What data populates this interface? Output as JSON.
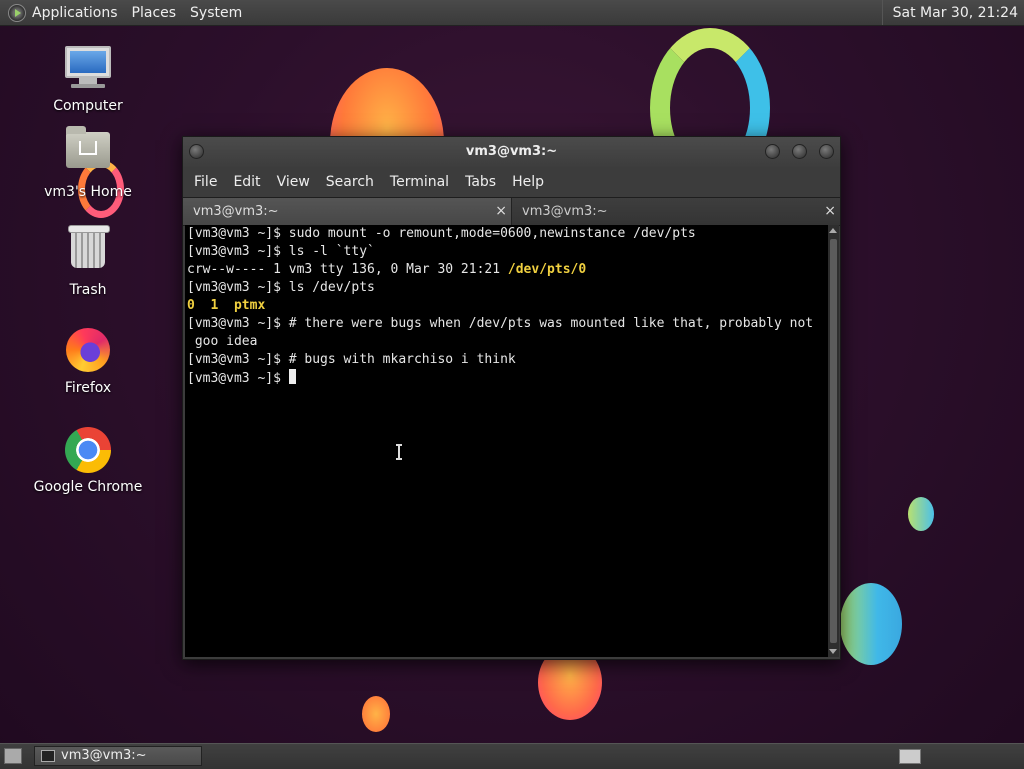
{
  "top_panel": {
    "menus": [
      "Applications",
      "Places",
      "System"
    ],
    "clock": "Sat Mar 30, 21:24"
  },
  "desktop_icons": [
    {
      "label": "Computer",
      "icon": "computer-icon"
    },
    {
      "label": "vm3's Home",
      "icon": "home-folder-icon"
    },
    {
      "label": "Trash",
      "icon": "trash-icon"
    },
    {
      "label": "Firefox",
      "icon": "firefox-icon"
    },
    {
      "label": "Google Chrome",
      "icon": "chrome-icon"
    }
  ],
  "terminal": {
    "title": "vm3@vm3:~",
    "menubar": [
      "File",
      "Edit",
      "View",
      "Search",
      "Terminal",
      "Tabs",
      "Help"
    ],
    "tabs": [
      {
        "label": "vm3@vm3:~",
        "active": true
      },
      {
        "label": "vm3@vm3:~",
        "active": false
      }
    ],
    "close_glyph": "×",
    "lines": [
      {
        "prompt": "[vm3@vm3 ~]$ ",
        "text": "sudo mount -o remount,mode=0600,newinstance /dev/pts"
      },
      {
        "prompt": "[vm3@vm3 ~]$ ",
        "text": "ls -l `tty`"
      },
      {
        "prompt": "",
        "text": "crw--w---- 1 vm3 tty 136, 0 Mar 30 21:21 ",
        "highlight": "/dev/pts/0"
      },
      {
        "prompt": "[vm3@vm3 ~]$ ",
        "text": "ls /dev/pts"
      },
      {
        "prompt": "",
        "text": "",
        "highlight": "0  1  ptmx"
      },
      {
        "prompt": "[vm3@vm3 ~]$ ",
        "text": "# there were bugs when /dev/pts was mounted like that, probably not"
      },
      {
        "prompt": "",
        "text": " goo idea"
      },
      {
        "prompt": "[vm3@vm3 ~]$ ",
        "text": "# bugs with mkarchiso i think"
      },
      {
        "prompt": "[vm3@vm3 ~]$ ",
        "text": "",
        "cursor": true
      }
    ]
  },
  "taskbar": {
    "window_button": "vm3@vm3:~"
  },
  "colors": {
    "highlight": "#f0d040",
    "terminal_bg": "#000000",
    "desktop_bg": "#2a0f2a"
  }
}
